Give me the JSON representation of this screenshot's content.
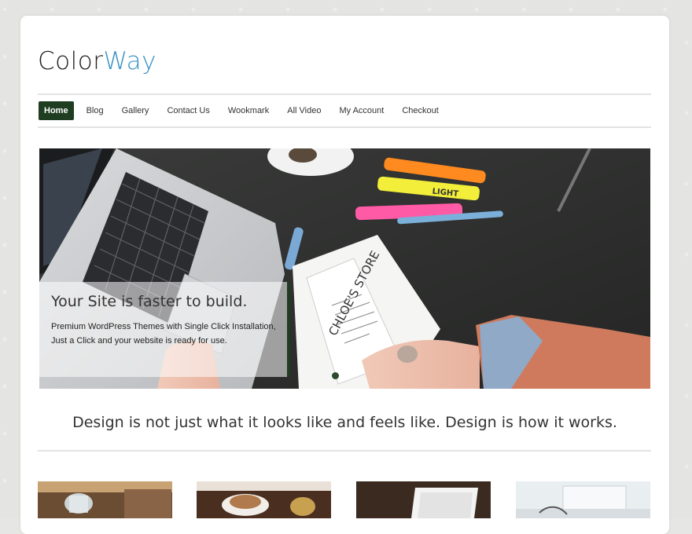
{
  "site": {
    "logo_part1": "Color",
    "logo_part2": "Way"
  },
  "nav": {
    "items": [
      {
        "label": "Home",
        "active": true
      },
      {
        "label": "Blog"
      },
      {
        "label": "Gallery"
      },
      {
        "label": "Contact Us"
      },
      {
        "label": "Wookmark"
      },
      {
        "label": "All Video"
      },
      {
        "label": "My Account"
      },
      {
        "label": "Checkout"
      }
    ]
  },
  "slider": {
    "caption_title": "Your Site is faster to build.",
    "caption_text": "Premium WordPress Themes with Single Click Installation, Just a Click and your website is ready for use.",
    "highlighter_label": "LIGHT",
    "notebook_text": "CHLOE'S STORE",
    "slide_count": 2,
    "active_slide": 1
  },
  "tagline": "Design is not just what it looks like and feels like. Design is how it works.",
  "colors": {
    "accent": "#3c93c4",
    "nav_active": "#1f3d21",
    "caption_bar": "#1f3d21"
  }
}
